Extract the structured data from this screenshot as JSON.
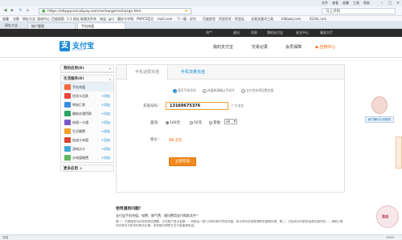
{
  "browser": {
    "menu": [
      "文件",
      "查看",
      "收藏",
      "工具",
      "帮助"
    ],
    "url": "https://ebppprod.alipay.com/recharge/recharge.htm",
    "search_placeholder": "马上识别",
    "bookmarks": [
      "收藏",
      "谷歌",
      "网址大全",
      "游戏中心",
      "百度搜索",
      "1-1 网址",
      "新建文件夹",
      "淘宝",
      "gcc",
      "最好卡乎网",
      "PHPCS官方",
      "mail.com",
      "下一篇 - 好分",
      "百度经验",
      "阿里旺旺 - 阿里云",
      "长尾关键词工具",
      "kfbbwq.com",
      "623hj.com"
    ],
    "tabs": [
      "网址大全",
      "账户管理",
      "手机充值"
    ]
  },
  "topbar": {
    "user": "刘**",
    "links": [
      "退出",
      "消息",
      "我的支付宝",
      "安全中心",
      "服务大厅"
    ]
  },
  "header": {
    "logo_mark": "支",
    "logo_text": "支付宝",
    "logo_sub": "ALIPAY",
    "nav": [
      "我的支付宝",
      "交易记录",
      "会员保障",
      "◆ 应用中心"
    ]
  },
  "sidebar": {
    "my_apps": "我的应用",
    "my_apps_count": "(8)",
    "life_section": "生活服务",
    "life_count": "(8)",
    "items": [
      {
        "label": "手机充值",
        "color": "#f26b3a",
        "add": ""
      },
      {
        "label": "信用卡还款",
        "color": "#e9463b",
        "add": "+添加"
      },
      {
        "label": "转账汇款",
        "color": "#3b8de0",
        "add": "+添加"
      },
      {
        "label": "缴纳交通罚款",
        "color": "#2aa567",
        "add": "+添加"
      },
      {
        "label": "校园一卡通",
        "color": "#7a59c9",
        "add": "+添加"
      },
      {
        "label": "生活缴费",
        "color": "#f2a12b",
        "add": "+添加"
      },
      {
        "label": "加油卡充值",
        "color": "#d9432f",
        "add": "+添加"
      },
      {
        "label": "游戏点卡",
        "color": "#3fa9d6",
        "add": "+添加"
      },
      {
        "label": "水电煤缴费",
        "color": "#5cb85c",
        "add": "+添加"
      }
    ],
    "more": "更多应用 >"
  },
  "main": {
    "tabs": [
      "手机话费充值",
      "手机流量充值"
    ],
    "steps": [
      {
        "num": "1",
        "label": "填写手机号码"
      },
      {
        "num": "2",
        "label": "充值前请确认手机号"
      },
      {
        "num": "3",
        "label": "支付完成将话费充值"
      }
    ],
    "phone_label": "充值号码：",
    "phone_value": "13160675376",
    "carrier": "广东电信",
    "amount_label": "面值：",
    "amount_options": [
      "100元",
      "50元",
      "其他"
    ],
    "other_value": "30",
    "price_label": "售价：",
    "price_value": "99.2元",
    "pay_button": "立即充值"
  },
  "help": {
    "title": "使用遇到问题？",
    "subtitle": "支付宝手机充值、电费、燃气费、通讯费用支付帮助文件？",
    "text": "第一：已缴费成功并收到短信提醒，已在账户显示金额……到账后一般1分钟内即可完成充值，若长时间未到账请联系客服处理。第二：已经成功付款但话费充值失败……请耐心等待并核对手机号码是否正确，如有疑问请拨打支付宝客服电话。"
  },
  "floaters": {
    "cs_label": "我们随时为您服务",
    "baby": "80"
  },
  "status": {
    "left": "完成",
    "right": "100%"
  }
}
